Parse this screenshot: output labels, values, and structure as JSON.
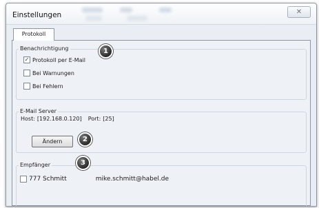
{
  "window": {
    "title": "Einstellungen",
    "close_glyph": "✕"
  },
  "tabs": [
    {
      "label": "Protokoll",
      "selected": true
    }
  ],
  "notification": {
    "group_label": "Benachrichtigung",
    "badge": "1",
    "options": [
      {
        "label": "Protokoll per E-Mail",
        "checked": true
      },
      {
        "label": "Bei Warnungen",
        "checked": false
      },
      {
        "label": "Bei Fehlern",
        "checked": false
      }
    ]
  },
  "email_server": {
    "group_label": "E-Mail Server",
    "host_label": "Host:",
    "host_value": "[192.168.0.120]",
    "port_label": "Port:",
    "port_value": "[25]",
    "edit_button": "Ändern",
    "badge": "2"
  },
  "recipients": {
    "group_label": "Empfänger",
    "badge": "3",
    "items": [
      {
        "name": "777 Schmitt",
        "email": "mike.schmitt@habel.de",
        "checked": false
      }
    ]
  },
  "icons": {
    "checkbox_checked": "check-icon",
    "close": "close-icon"
  }
}
